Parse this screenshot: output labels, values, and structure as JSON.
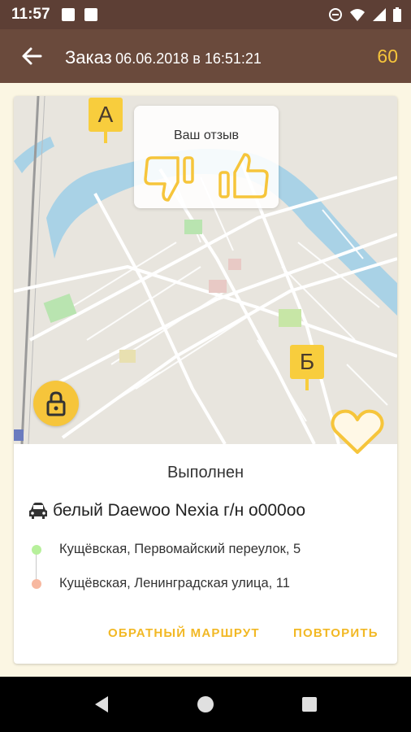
{
  "status_bar": {
    "time": "11:57"
  },
  "app_bar": {
    "title": "Заказ",
    "datetime": "06.06.2018 в 16:51:21",
    "counter": "60"
  },
  "map": {
    "marker_start": "А",
    "marker_end": "Б",
    "feedback": {
      "title": "Ваш отзыв"
    }
  },
  "order": {
    "status": "Выполнен",
    "car": "белый Daewoo Nexia г/н о000оо",
    "route": [
      {
        "address": "Кущёвская, Первомайский переулок, 5",
        "color": "#b7f09b"
      },
      {
        "address": "Кущёвская, Ленинградская улица, 11",
        "color": "#f7b8a0"
      }
    ]
  },
  "actions": {
    "reverse_route": "ОБРАТНЫЙ МАРШРУТ",
    "repeat": "ПОВТОРИТЬ"
  },
  "colors": {
    "status_bar": "#5d3f35",
    "app_bar": "#6a4a3c",
    "accent": "#f6c53b",
    "background": "#fbf6e3"
  },
  "icons": {
    "back": "arrow-left-icon",
    "dislike": "thumbs-down-icon",
    "like": "thumbs-up-icon",
    "lock": "lock-icon",
    "favorite": "heart-icon",
    "car": "car-icon"
  }
}
